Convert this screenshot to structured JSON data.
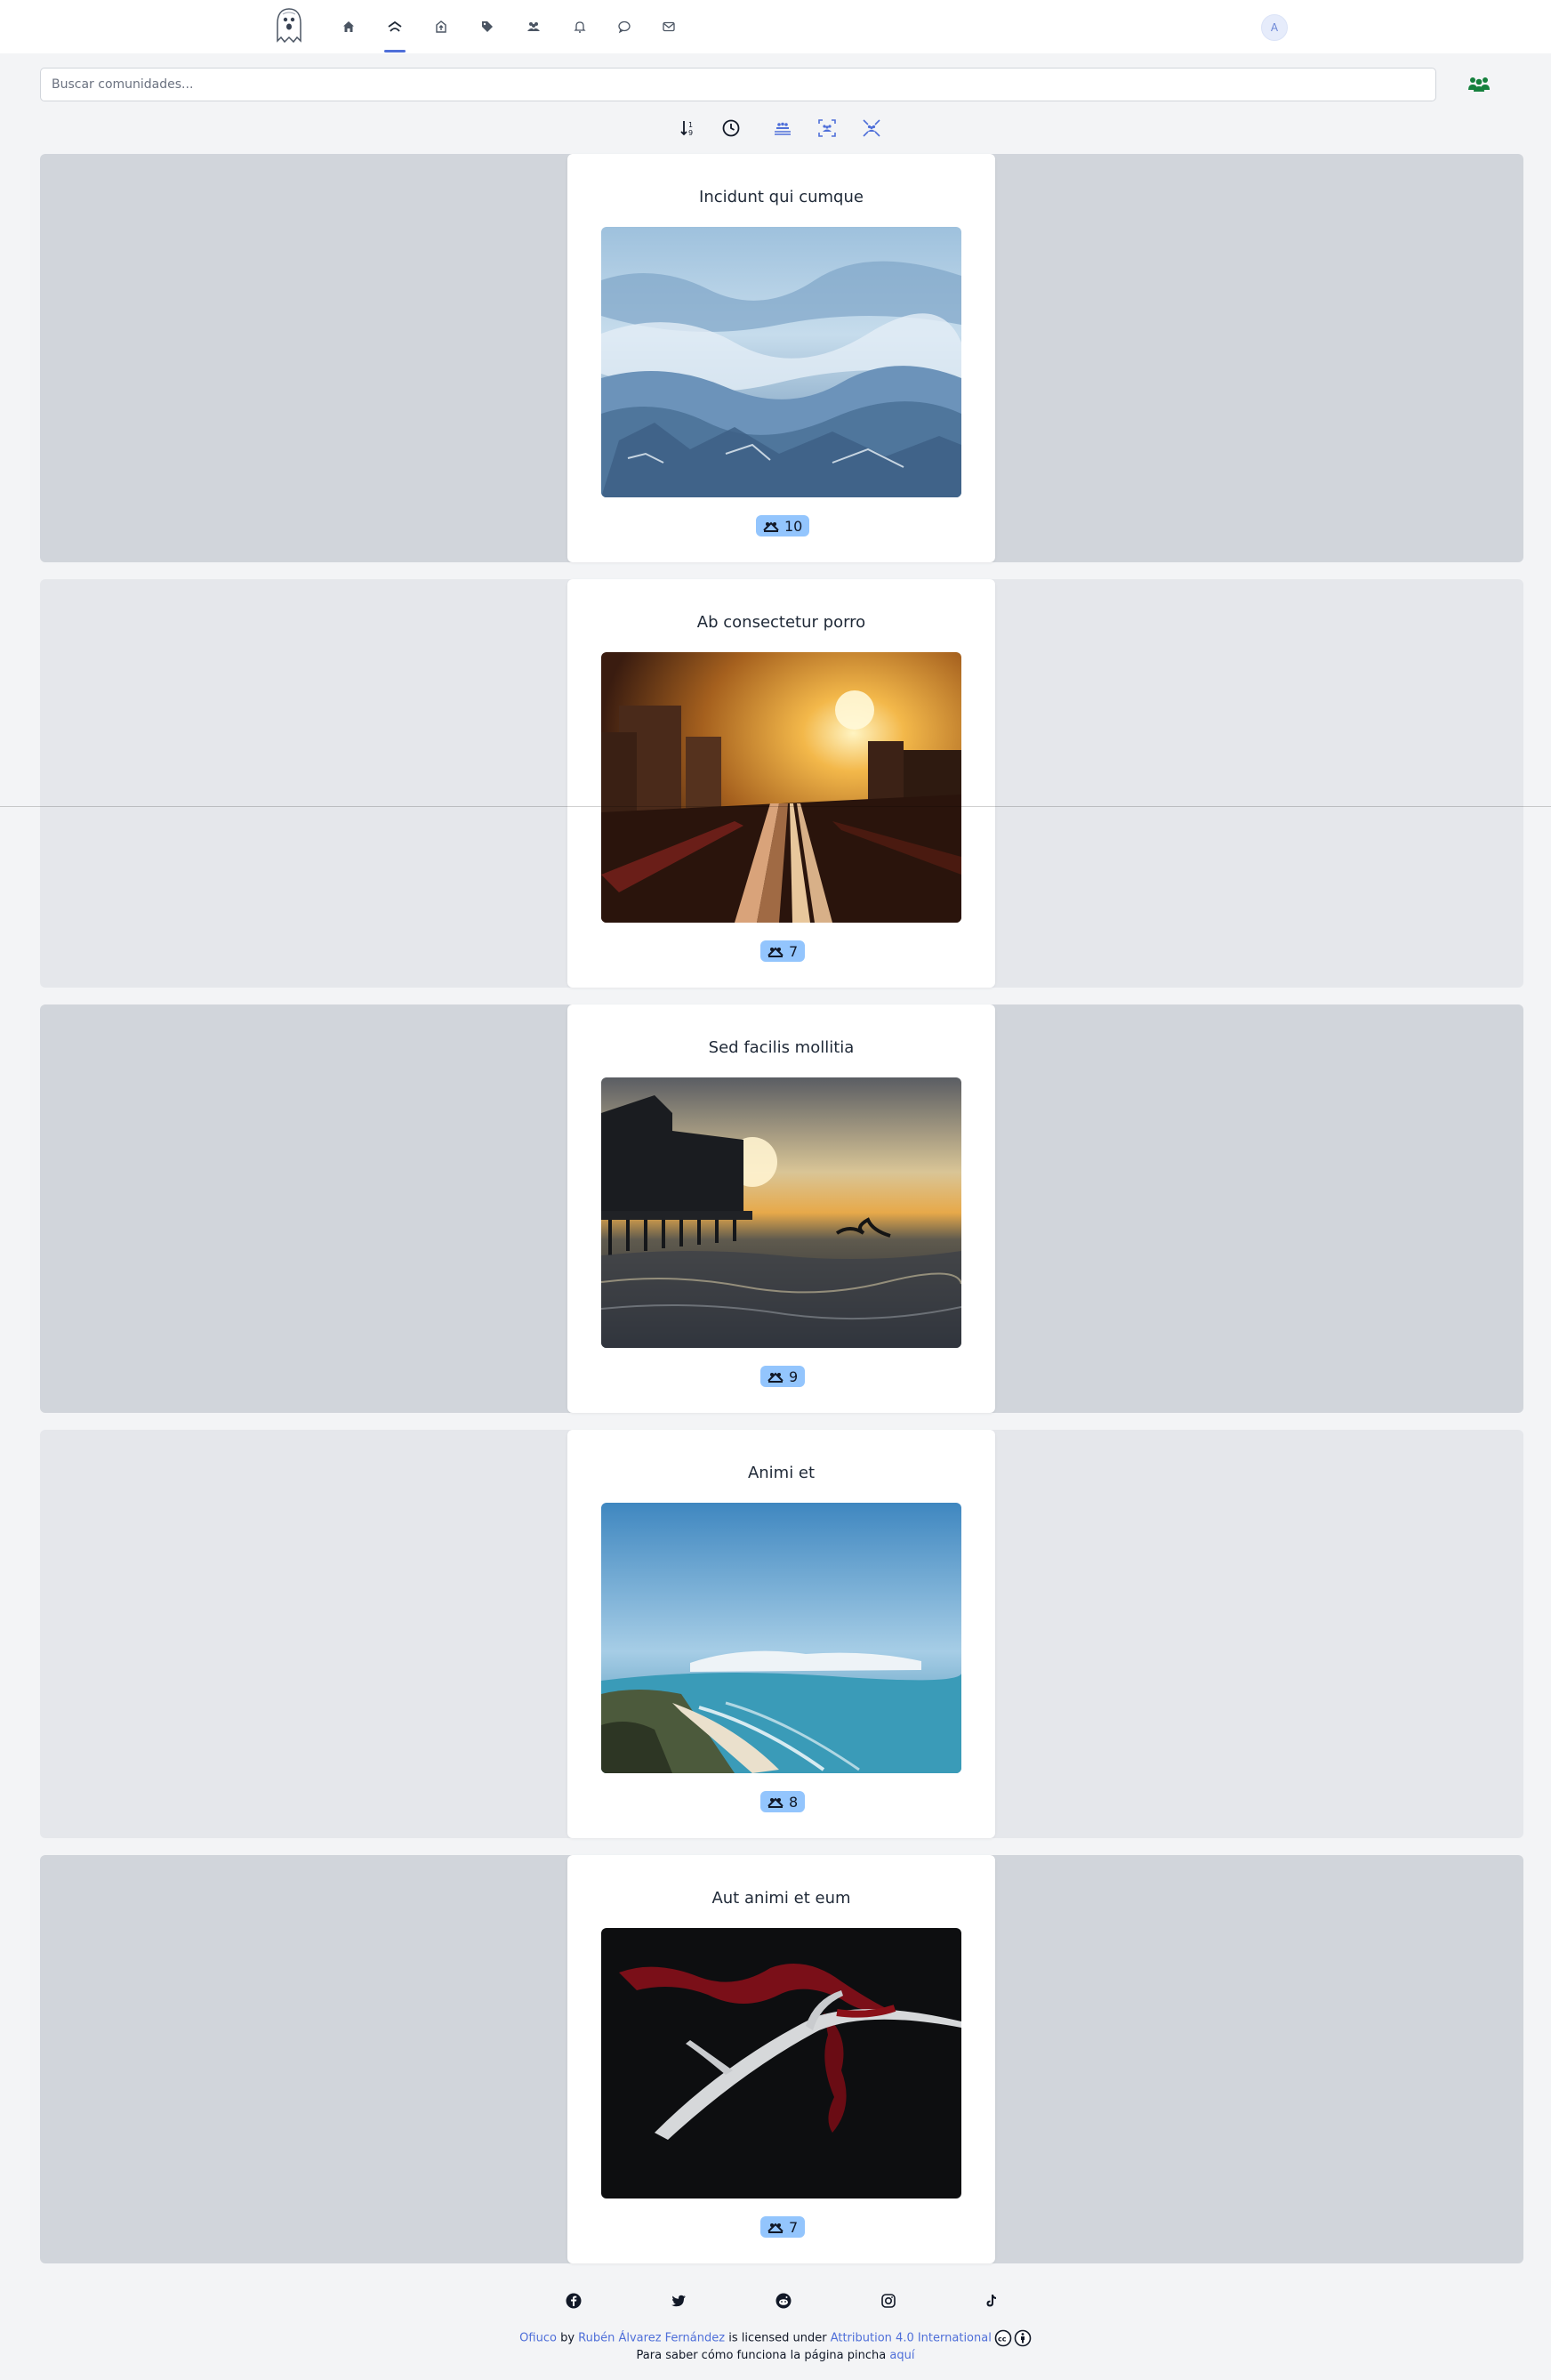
{
  "navbar": {
    "items": [
      {
        "name": "home-icon",
        "active": false
      },
      {
        "name": "communities-icon",
        "active": true
      },
      {
        "name": "upload-icon",
        "active": false
      },
      {
        "name": "tag-icon",
        "active": false
      },
      {
        "name": "users-icon",
        "active": false
      },
      {
        "name": "bell-icon",
        "active": false
      },
      {
        "name": "chat-icon",
        "active": false
      },
      {
        "name": "mail-icon",
        "active": false
      }
    ],
    "avatar_initial": "A",
    "accent_color": "#4f6fd9"
  },
  "search": {
    "placeholder": "Buscar comunidades...",
    "value": ""
  },
  "toolbar": {
    "icons": [
      "sort-icon",
      "clock-icon",
      "layout-list-icon",
      "layout-grid-icon",
      "layout-expand-icon"
    ]
  },
  "communities": [
    {
      "title": "Incidunt qui cumque",
      "members": "10",
      "image": "misty-mountains"
    },
    {
      "title": "Ab consectetur porro",
      "members": "7",
      "image": "sunset-city-train"
    },
    {
      "title": "Sed facilis mollitia",
      "members": "9",
      "image": "pier-sunset-seagull"
    },
    {
      "title": "Animi et",
      "members": "8",
      "image": "coastline-sky"
    },
    {
      "title": "Aut animi et eum",
      "members": "7",
      "image": "antler-red-ribbon"
    }
  ],
  "footer": {
    "social": [
      "facebook-icon",
      "twitter-icon",
      "reddit-icon",
      "instagram-icon",
      "tiktok-icon"
    ],
    "site_name": "Ofiuco",
    "by": "by",
    "author": "Rubén Álvarez Fernández",
    "licensed": "is licensed under",
    "license": "Attribution 4.0 International",
    "help_text": "Para saber cómo funciona la página pincha",
    "help_link": "aquí"
  }
}
